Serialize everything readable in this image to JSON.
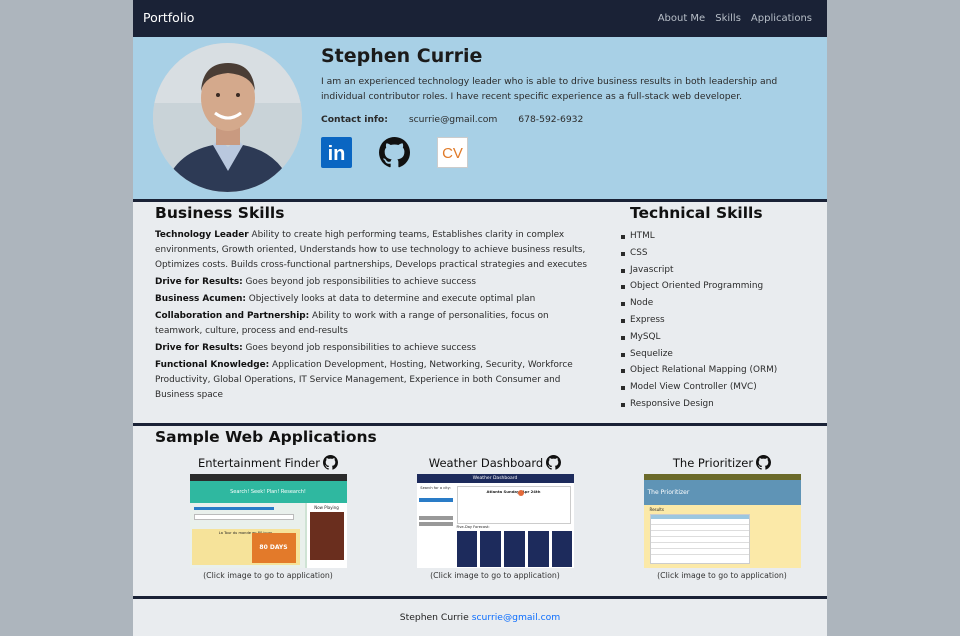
{
  "nav": {
    "brand": "Portfolio",
    "links": [
      "About Me",
      "Skills",
      "Applications"
    ]
  },
  "profile": {
    "name": "Stephen Currie",
    "description": "I am an experienced technology leader who is able to drive business results in both leadership and individual contributor roles. I have recent specific experience as a full-stack web developer.",
    "contact_label": "Contact info:",
    "email": "scurrie@gmail.com",
    "phone": "678-592-6932",
    "socials": [
      {
        "icon": "linkedin-icon",
        "label": "in"
      },
      {
        "icon": "github-icon"
      },
      {
        "icon": "cv-icon",
        "label": "CV"
      }
    ]
  },
  "business": {
    "title": "Business Skills",
    "items": [
      {
        "label": "Technology Leader",
        "text": " Ability to create high performing teams, Establishes clarity in complex environments, Growth oriented, Understands how to use technology to achieve business results, Optimizes costs. Builds cross-functional partnerships, Develops practical strategies and executes"
      },
      {
        "label": "Drive for Results:",
        "text": " Goes beyond job responsibilities to achieve success"
      },
      {
        "label": "Business Acumen:",
        "text": " Objectively looks at data to determine and execute optimal plan"
      },
      {
        "label": "Collaboration and Partnership:",
        "text": " Ability to work with a range of personalities, focus on teamwork, culture, process and end-results"
      },
      {
        "label": "Drive for Results:",
        "text": " Goes beyond job responsibilities to achieve success"
      },
      {
        "label": "Functional Knowledge:",
        "text": " Application Development, Hosting, Networking, Security, Workforce Productivity, Global Operations, IT Service Management, Experience in both Consumer and Business space"
      }
    ]
  },
  "technical": {
    "title": "Technical Skills",
    "items": [
      "HTML",
      "CSS",
      "Javascript",
      "Object Oriented Programming",
      "Node",
      "Express",
      "MySQL",
      "Sequelize",
      "Object Relational Mapping (ORM)",
      "Model View Controller (MVC)",
      "Responsive Design"
    ]
  },
  "apps": {
    "title": "Sample Web Applications",
    "caption": "(Click image to go to application)",
    "items": [
      {
        "title": "Entertainment Finder",
        "thumb": {
          "header": "Search! Seek! Plan! Research!",
          "side": "Now Playing",
          "film": "La Tour du monde en 80 jours",
          "poster": "80 DAYS"
        }
      },
      {
        "title": "Weather Dashboard",
        "thumb": {
          "header": "Weather Dashboard",
          "search": "Search for a city:",
          "city": "Atlanta Sunday, Apr 24th",
          "forecast": "Five-Day Forecast:"
        }
      },
      {
        "title": "The Prioritizer",
        "thumb": {
          "header": "The Prioritizer",
          "results": "Results"
        }
      }
    ]
  },
  "footer": {
    "name": "Stephen Currie",
    "email": "scurrie@gmail.com"
  },
  "colors": {
    "navbar": "#1a2236",
    "hero": "#a8d0e6",
    "page": "#e9ecef",
    "backdrop": "#adb5bd",
    "link": "#0d6efd",
    "linkedin": "#0a66c2",
    "cv": "#e07b2a"
  }
}
